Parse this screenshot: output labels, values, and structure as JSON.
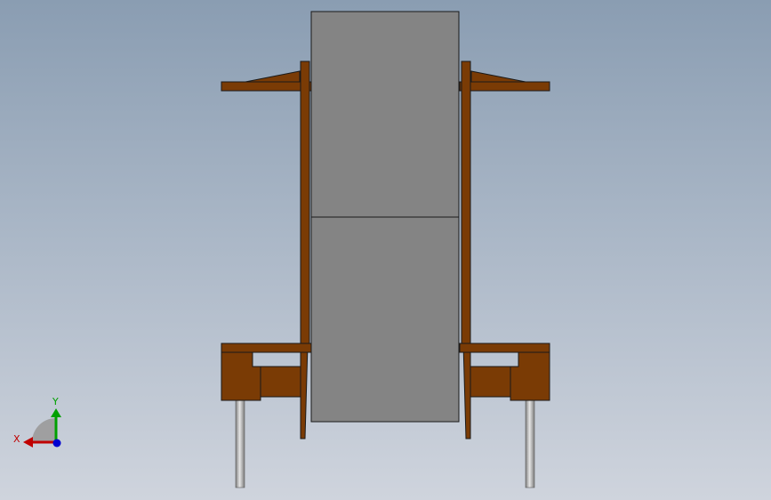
{
  "triad": {
    "x_label": "X",
    "y_label": "Y"
  },
  "colors": {
    "background_top": "#8a9db2",
    "background_bottom": "#cfd4dd",
    "core_fill": "#848484",
    "bobbin_fill": "#7a3b05",
    "pin_fill": "#b7b7b7",
    "outline": "#1a1a1a",
    "axis_x": "#c00000",
    "axis_y": "#00a000",
    "axis_z": "#0000d0"
  }
}
